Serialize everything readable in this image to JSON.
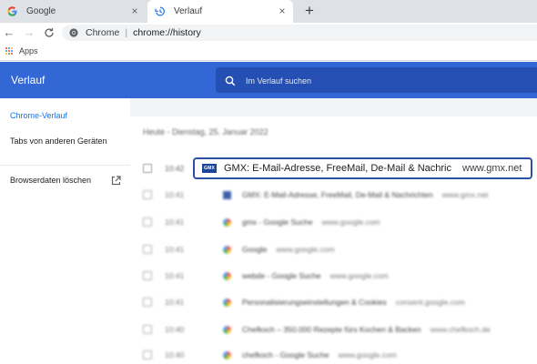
{
  "browser": {
    "tabs": [
      {
        "title": "Google",
        "favicon": "google-g-icon"
      },
      {
        "title": "Verlauf",
        "favicon": "history-icon",
        "active": true
      }
    ],
    "omnibox": {
      "site_label": "Chrome",
      "separator": "|",
      "url": "chrome://history"
    },
    "bookmarks": {
      "apps_label": "Apps"
    }
  },
  "header": {
    "title": "Verlauf",
    "search_placeholder": "Im Verlauf suchen",
    "color": "#3367d6"
  },
  "sidebar": {
    "items": [
      {
        "label": "Chrome-Verlauf",
        "active": true
      },
      {
        "label": "Tabs von anderen Geräten"
      },
      {
        "label": "Browserdaten löschen",
        "icon": "external-link-icon"
      }
    ]
  },
  "history": {
    "date_heading": "Heute - Dienstag, 25. Januar 2022",
    "focused": {
      "time": "10:42",
      "title": "GMX: E-Mail-Adresse, FreeMail, De-Mail & Nachrichten",
      "domain": "www.gmx.net",
      "favicon_text": "GMX"
    },
    "rows": [
      {
        "time": "10:41",
        "title": "GMX: E-Mail-Adresse, FreeMail, De-Mail & Nachrichten",
        "domain": "www.gmx.net",
        "favicon": "gmx"
      },
      {
        "time": "10:41",
        "title": "gmx - Google Suche",
        "domain": "www.google.com",
        "favicon": "google"
      },
      {
        "time": "10:41",
        "title": "Google",
        "domain": "www.google.com",
        "favicon": "google"
      },
      {
        "time": "10:41",
        "title": "webde - Google Suche",
        "domain": "www.google.com",
        "favicon": "google"
      },
      {
        "time": "10:41",
        "title": "Personalisierungseinstellungen & Cookies",
        "domain": "consent.google.com",
        "favicon": "google"
      },
      {
        "time": "10:40",
        "title": "Chefkoch – 350.000 Rezepte fürs Kochen & Backen",
        "domain": "www.chefkoch.de",
        "favicon": "google"
      },
      {
        "time": "10:40",
        "title": "chefkoch - Google Suche",
        "domain": "www.google.com",
        "favicon": "google"
      }
    ]
  }
}
